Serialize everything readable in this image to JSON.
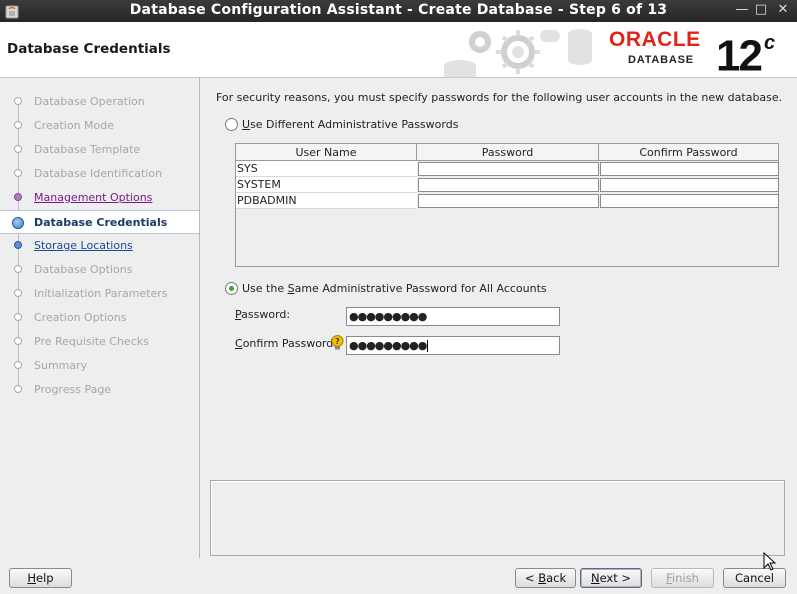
{
  "window": {
    "title": "Database Configuration Assistant - Create Database - Step 6 of 13",
    "controls": [
      "minimize-icon",
      "maximize-icon",
      "close-icon"
    ]
  },
  "header": {
    "page_title": "Database Credentials",
    "logo_brand": "ORACLE",
    "logo_sub": "DATABASE",
    "logo_version": "12",
    "logo_version_suffix": "c"
  },
  "steps": [
    {
      "label": "Database Operation",
      "state": "done"
    },
    {
      "label": "Creation Mode",
      "state": "done"
    },
    {
      "label": "Database Template",
      "state": "done"
    },
    {
      "label": "Database Identification",
      "state": "done"
    },
    {
      "label": "Management Options",
      "state": "visited"
    },
    {
      "label": "Database Credentials",
      "state": "current"
    },
    {
      "label": "Storage Locations",
      "state": "link"
    },
    {
      "label": "Database Options",
      "state": "pending"
    },
    {
      "label": "Initialization Parameters",
      "state": "pending"
    },
    {
      "label": "Creation Options",
      "state": "pending"
    },
    {
      "label": "Pre Requisite Checks",
      "state": "pending"
    },
    {
      "label": "Summary",
      "state": "pending"
    },
    {
      "label": "Progress Page",
      "state": "pending"
    }
  ],
  "main": {
    "intro": "For security reasons, you must specify passwords for the following user accounts in the new database.",
    "radio_different": {
      "mnemonic": "U",
      "rest": "se Different Administrative Passwords",
      "selected": false
    },
    "table": {
      "columns": [
        "User Name",
        "Password",
        "Confirm Password"
      ],
      "rows": [
        {
          "user": "SYS",
          "password": "",
          "confirm": ""
        },
        {
          "user": "SYSTEM",
          "password": "",
          "confirm": ""
        },
        {
          "user": "PDBADMIN",
          "password": "",
          "confirm": ""
        }
      ]
    },
    "radio_same": {
      "pre": "Use the ",
      "mnemonic": "S",
      "rest": "ame Administrative Password for All Accounts",
      "selected": true
    },
    "password": {
      "mnemonic": "P",
      "rest": "assword:",
      "value": "●●●●●●●●●"
    },
    "confirm_password": {
      "mnemonic": "C",
      "rest": "onfirm Password:",
      "value": "●●●●●●●●●"
    }
  },
  "buttons": {
    "help": {
      "mnemonic": "H",
      "rest": "elp"
    },
    "back": {
      "prefix": "< ",
      "mnemonic": "B",
      "rest": "ack"
    },
    "next": {
      "mnemonic": "N",
      "rest": "ext >"
    },
    "finish": {
      "mnemonic": "F",
      "rest": "inish"
    },
    "cancel": {
      "label": "Cancel"
    }
  },
  "colors": {
    "titlebar": "#2e2e2e",
    "oracle_red": "#e2231a",
    "link": "#1a4a9a",
    "visited": "#7a1a8a"
  }
}
